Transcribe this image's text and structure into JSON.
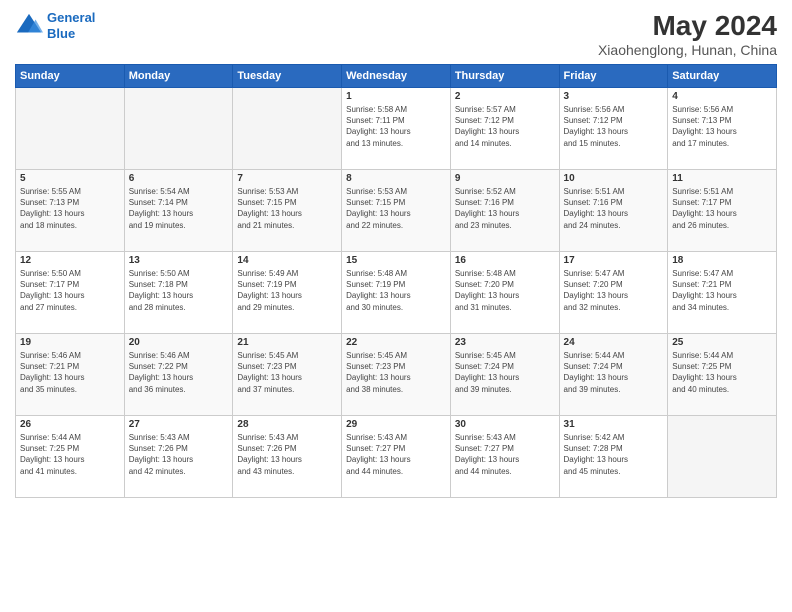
{
  "header": {
    "logo_line1": "General",
    "logo_line2": "Blue",
    "main_title": "May 2024",
    "subtitle": "Xiaohenglong, Hunan, China"
  },
  "days_of_week": [
    "Sunday",
    "Monday",
    "Tuesday",
    "Wednesday",
    "Thursday",
    "Friday",
    "Saturday"
  ],
  "weeks": [
    [
      {
        "num": "",
        "info": "",
        "empty": true
      },
      {
        "num": "",
        "info": "",
        "empty": true
      },
      {
        "num": "",
        "info": "",
        "empty": true
      },
      {
        "num": "1",
        "info": "Sunrise: 5:58 AM\nSunset: 7:11 PM\nDaylight: 13 hours\nand 13 minutes.",
        "empty": false
      },
      {
        "num": "2",
        "info": "Sunrise: 5:57 AM\nSunset: 7:12 PM\nDaylight: 13 hours\nand 14 minutes.",
        "empty": false
      },
      {
        "num": "3",
        "info": "Sunrise: 5:56 AM\nSunset: 7:12 PM\nDaylight: 13 hours\nand 15 minutes.",
        "empty": false
      },
      {
        "num": "4",
        "info": "Sunrise: 5:56 AM\nSunset: 7:13 PM\nDaylight: 13 hours\nand 17 minutes.",
        "empty": false
      }
    ],
    [
      {
        "num": "5",
        "info": "Sunrise: 5:55 AM\nSunset: 7:13 PM\nDaylight: 13 hours\nand 18 minutes.",
        "empty": false
      },
      {
        "num": "6",
        "info": "Sunrise: 5:54 AM\nSunset: 7:14 PM\nDaylight: 13 hours\nand 19 minutes.",
        "empty": false
      },
      {
        "num": "7",
        "info": "Sunrise: 5:53 AM\nSunset: 7:15 PM\nDaylight: 13 hours\nand 21 minutes.",
        "empty": false
      },
      {
        "num": "8",
        "info": "Sunrise: 5:53 AM\nSunset: 7:15 PM\nDaylight: 13 hours\nand 22 minutes.",
        "empty": false
      },
      {
        "num": "9",
        "info": "Sunrise: 5:52 AM\nSunset: 7:16 PM\nDaylight: 13 hours\nand 23 minutes.",
        "empty": false
      },
      {
        "num": "10",
        "info": "Sunrise: 5:51 AM\nSunset: 7:16 PM\nDaylight: 13 hours\nand 24 minutes.",
        "empty": false
      },
      {
        "num": "11",
        "info": "Sunrise: 5:51 AM\nSunset: 7:17 PM\nDaylight: 13 hours\nand 26 minutes.",
        "empty": false
      }
    ],
    [
      {
        "num": "12",
        "info": "Sunrise: 5:50 AM\nSunset: 7:17 PM\nDaylight: 13 hours\nand 27 minutes.",
        "empty": false
      },
      {
        "num": "13",
        "info": "Sunrise: 5:50 AM\nSunset: 7:18 PM\nDaylight: 13 hours\nand 28 minutes.",
        "empty": false
      },
      {
        "num": "14",
        "info": "Sunrise: 5:49 AM\nSunset: 7:19 PM\nDaylight: 13 hours\nand 29 minutes.",
        "empty": false
      },
      {
        "num": "15",
        "info": "Sunrise: 5:48 AM\nSunset: 7:19 PM\nDaylight: 13 hours\nand 30 minutes.",
        "empty": false
      },
      {
        "num": "16",
        "info": "Sunrise: 5:48 AM\nSunset: 7:20 PM\nDaylight: 13 hours\nand 31 minutes.",
        "empty": false
      },
      {
        "num": "17",
        "info": "Sunrise: 5:47 AM\nSunset: 7:20 PM\nDaylight: 13 hours\nand 32 minutes.",
        "empty": false
      },
      {
        "num": "18",
        "info": "Sunrise: 5:47 AM\nSunset: 7:21 PM\nDaylight: 13 hours\nand 34 minutes.",
        "empty": false
      }
    ],
    [
      {
        "num": "19",
        "info": "Sunrise: 5:46 AM\nSunset: 7:21 PM\nDaylight: 13 hours\nand 35 minutes.",
        "empty": false
      },
      {
        "num": "20",
        "info": "Sunrise: 5:46 AM\nSunset: 7:22 PM\nDaylight: 13 hours\nand 36 minutes.",
        "empty": false
      },
      {
        "num": "21",
        "info": "Sunrise: 5:45 AM\nSunset: 7:23 PM\nDaylight: 13 hours\nand 37 minutes.",
        "empty": false
      },
      {
        "num": "22",
        "info": "Sunrise: 5:45 AM\nSunset: 7:23 PM\nDaylight: 13 hours\nand 38 minutes.",
        "empty": false
      },
      {
        "num": "23",
        "info": "Sunrise: 5:45 AM\nSunset: 7:24 PM\nDaylight: 13 hours\nand 39 minutes.",
        "empty": false
      },
      {
        "num": "24",
        "info": "Sunrise: 5:44 AM\nSunset: 7:24 PM\nDaylight: 13 hours\nand 39 minutes.",
        "empty": false
      },
      {
        "num": "25",
        "info": "Sunrise: 5:44 AM\nSunset: 7:25 PM\nDaylight: 13 hours\nand 40 minutes.",
        "empty": false
      }
    ],
    [
      {
        "num": "26",
        "info": "Sunrise: 5:44 AM\nSunset: 7:25 PM\nDaylight: 13 hours\nand 41 minutes.",
        "empty": false
      },
      {
        "num": "27",
        "info": "Sunrise: 5:43 AM\nSunset: 7:26 PM\nDaylight: 13 hours\nand 42 minutes.",
        "empty": false
      },
      {
        "num": "28",
        "info": "Sunrise: 5:43 AM\nSunset: 7:26 PM\nDaylight: 13 hours\nand 43 minutes.",
        "empty": false
      },
      {
        "num": "29",
        "info": "Sunrise: 5:43 AM\nSunset: 7:27 PM\nDaylight: 13 hours\nand 44 minutes.",
        "empty": false
      },
      {
        "num": "30",
        "info": "Sunrise: 5:43 AM\nSunset: 7:27 PM\nDaylight: 13 hours\nand 44 minutes.",
        "empty": false
      },
      {
        "num": "31",
        "info": "Sunrise: 5:42 AM\nSunset: 7:28 PM\nDaylight: 13 hours\nand 45 minutes.",
        "empty": false
      },
      {
        "num": "",
        "info": "",
        "empty": true
      }
    ]
  ]
}
